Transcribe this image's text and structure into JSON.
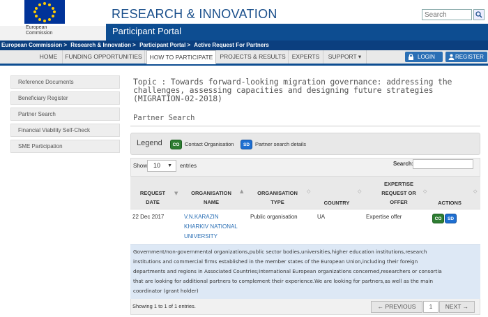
{
  "header": {
    "logo_text_line1": "European",
    "logo_text_line2": "Commission",
    "site_title": "RESEARCH & INNOVATION",
    "search_placeholder": "Search",
    "portal_title": "Participant Portal"
  },
  "breadcrumb": [
    "European Commission >",
    "Research & Innovation >",
    "Participant Portal >",
    "Active Request For Partners"
  ],
  "nav": {
    "items": [
      "HOME",
      "FUNDING OPPORTUNITIES",
      "HOW TO PARTICIPATE",
      "PROJECTS & RESULTS",
      "EXPERTS",
      "SUPPORT ▾"
    ],
    "active": "HOW TO PARTICIPATE",
    "login": "LOGIN",
    "register": "REGISTER"
  },
  "sidebar": {
    "items": [
      {
        "label": "Reference Documents"
      },
      {
        "label": "Beneficiary Register"
      },
      {
        "label": "Partner Search"
      },
      {
        "label": "Financial Viability Self-Check"
      },
      {
        "label": "SME Participation"
      }
    ]
  },
  "main": {
    "topic_line1": "Topic : Towards forward-looking migration governance: addressing the",
    "topic_line2": "challenges, assessing capacities and designing future strategies",
    "topic_line3": "(MIGRATION-02-2018)",
    "section_title": "Partner Search",
    "legend": {
      "label": "Legend",
      "co_badge": "CO",
      "co_text": "Contact Organisation",
      "sd_badge": "SD",
      "sd_text": "Partner search details"
    },
    "table": {
      "show_label": "Show",
      "page_size": "10",
      "entries_label": "entries",
      "search_label": "Search:",
      "headers": {
        "date_l1": "REQUEST",
        "date_l2": "DATE",
        "org_l1": "ORGANISATION",
        "org_l2": "NAME",
        "type_l1": "ORGANISATION",
        "type_l2": "TYPE",
        "country": "COUNTRY",
        "exp_l1": "EXPERTISE",
        "exp_l2": "REQUEST OR",
        "exp_l3": "OFFER",
        "actions": "ACTIONS"
      },
      "rows": [
        {
          "date": "22 Dec 2017",
          "org_l1": "V.N.KARAZIN",
          "org_l2": "KHARKIV NATIONAL",
          "org_l3": "UNIVERSITY",
          "type": "Public organisation",
          "country": "UA",
          "expertise": "Expertise offer",
          "co": "CO",
          "sd": "SD"
        }
      ],
      "description_lines": [
        "Government/non-governmental organizations,public sector bodies,universities,higher education institutions,research",
        "institutions and commercial firms established in the member states of the European Union,including their foreign",
        "departments and regions in Associated Countries;International European organizations concerned,researchers or consortia",
        "that are looking for additional partners to complement their experience.We are looking for partners,as well as the main",
        "coordinator (grant holder)"
      ],
      "info": "Showing 1 to 1 of 1 entries.",
      "pagination": {
        "prev": "← PREVIOUS",
        "page": "1",
        "next": "NEXT →"
      }
    }
  },
  "colors": {
    "brand_blue": "#0d4d91",
    "breadcrumb_blue": "#0b3f7f",
    "co_green": "#2e7d32",
    "sd_blue": "#1e6fd1"
  }
}
